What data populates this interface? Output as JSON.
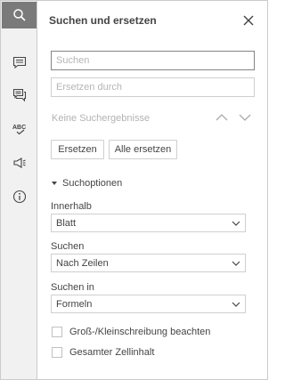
{
  "panel": {
    "title": "Suchen und ersetzen"
  },
  "toolbar": {
    "items": [
      {
        "name": "search-icon",
        "active": true
      },
      {
        "name": "comment-icon",
        "active": false
      },
      {
        "name": "chat-icon",
        "active": false
      },
      {
        "name": "spellcheck-icon",
        "active": false
      },
      {
        "name": "feedback-icon",
        "active": false
      },
      {
        "name": "info-icon",
        "active": false
      }
    ]
  },
  "search": {
    "placeholder": "Suchen",
    "value": ""
  },
  "replace": {
    "placeholder": "Ersetzen durch",
    "value": ""
  },
  "status": {
    "no_results": "Keine Suchergebnisse"
  },
  "buttons": {
    "replace": "Ersetzen",
    "replace_all": "Alle ersetzen"
  },
  "options": {
    "section_label": "Suchoptionen",
    "within_label": "Innerhalb",
    "within_value": "Blatt",
    "search_label": "Suchen",
    "search_value": "Nach Zeilen",
    "search_in_label": "Suchen in",
    "search_in_value": "Formeln",
    "match_case_label": "Groß-/Kleinschreibung beachten",
    "match_case_checked": false,
    "entire_cell_label": "Gesamter Zellinhalt",
    "entire_cell_checked": false
  },
  "colors": {
    "toolbar_bg": "#f1f1f1",
    "active_tool_bg": "#7a7a7a",
    "border": "#cfcfcf",
    "text": "#444444",
    "muted_text": "#b2b2b2"
  }
}
